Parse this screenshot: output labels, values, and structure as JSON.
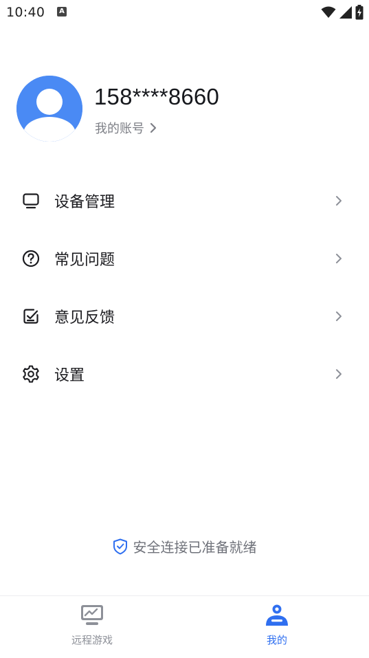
{
  "status_bar": {
    "time": "10:40",
    "notification_badge": "A"
  },
  "profile": {
    "phone": "158****8660",
    "account_link_label": "我的账号"
  },
  "menu": {
    "items": [
      {
        "label": "设备管理",
        "icon": "monitor-icon"
      },
      {
        "label": "常见问题",
        "icon": "question-icon"
      },
      {
        "label": "意见反馈",
        "icon": "feedback-icon"
      },
      {
        "label": "设置",
        "icon": "gear-icon"
      }
    ]
  },
  "secure_notice": {
    "text": "安全连接已准备就绪",
    "icon": "shield-check-icon"
  },
  "bottom_nav": {
    "items": [
      {
        "label": "远程游戏",
        "icon": "remote-game-icon",
        "active": false
      },
      {
        "label": "我的",
        "icon": "profile-icon",
        "active": true
      }
    ]
  },
  "colors": {
    "accent": "#2f6ff0",
    "avatar_bg": "#4a8af4",
    "inactive": "#8d9098",
    "text_primary": "#1b1b1f",
    "text_secondary": "#7d7f86"
  }
}
